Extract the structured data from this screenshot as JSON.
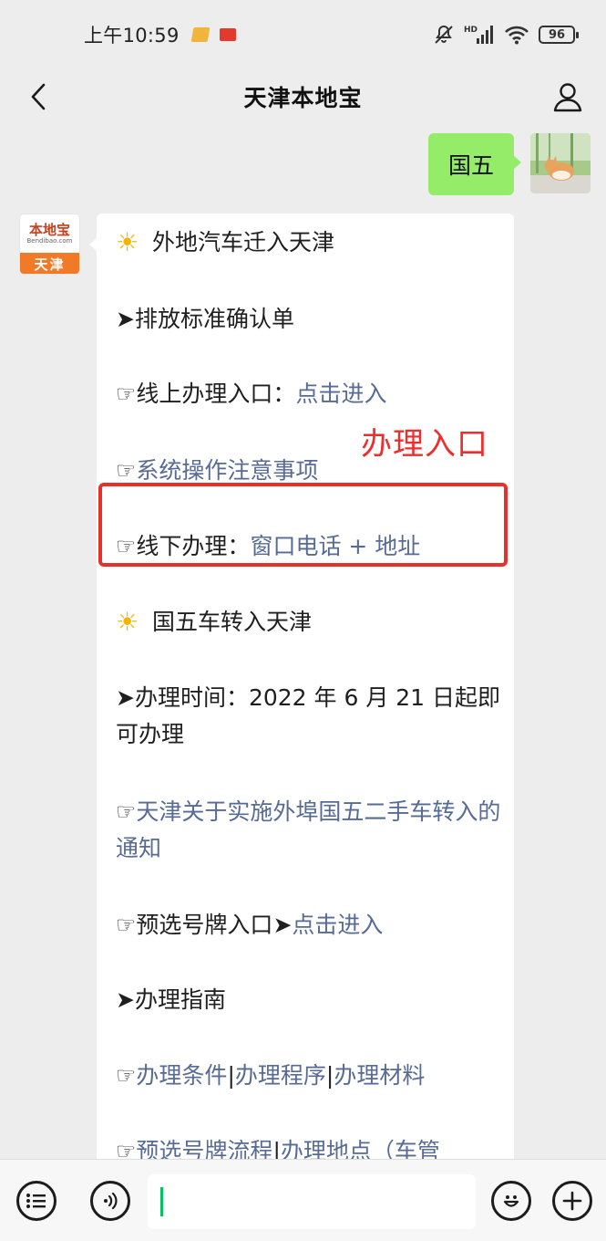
{
  "status": {
    "time": "上午10:59",
    "network_label": "HD",
    "battery": "96"
  },
  "nav": {
    "title": "天津本地宝"
  },
  "chat": {
    "my_message": "国五",
    "bot_avatar": {
      "logo_text": "本地宝",
      "logo_sub": "Bendibao.com",
      "city": "天津"
    },
    "overlay_label": "办理入口",
    "lines": {
      "l1": "外地汽车迁入天津",
      "l2_arrow": "➤",
      "l2": "排放标准确认单",
      "l3_hand": "☞",
      "l3_text": "线上办理入口：",
      "l3_link": "点击进入",
      "l4_hand": "☞",
      "l4_link": "系统操作注意事项",
      "l5_hand": "☞",
      "l5_text": "线下办理：",
      "l5_link": "窗口电话 + 地址",
      "l6": "国五车转入天津",
      "l7_arrow": "➤",
      "l7": "办理时间：2022 年 6 月 21 日起即可办理",
      "l8_hand": "☞",
      "l8_link": "天津关于实施外埠国五二手车转入的通知",
      "l9_hand": "☞",
      "l9_text": "预选号牌入口",
      "l9_arrow": "➤",
      "l9_link": "点击进入",
      "l10_arrow": "➤",
      "l10": "办理指南",
      "l11_hand": "☞",
      "l11_link1": "办理条件",
      "l11_sep1": "|",
      "l11_link2": "办理程序",
      "l11_sep2": "|",
      "l11_link3": "办理材料",
      "l12_hand": "☞",
      "l12_link1": "预选号牌流程",
      "l12_sep": "|",
      "l12_link2": "办理地点（车管"
    }
  },
  "colors": {
    "accent_green": "#07c160",
    "bubble_green": "#95ec69",
    "link": "#576b95",
    "highlight_red": "#e8302a"
  },
  "icons": {
    "back": "chevron-left-icon",
    "profile": "person-icon",
    "list": "menu-list-icon",
    "voice": "voice-icon",
    "emoji": "emoji-icon",
    "add": "plus-icon"
  }
}
